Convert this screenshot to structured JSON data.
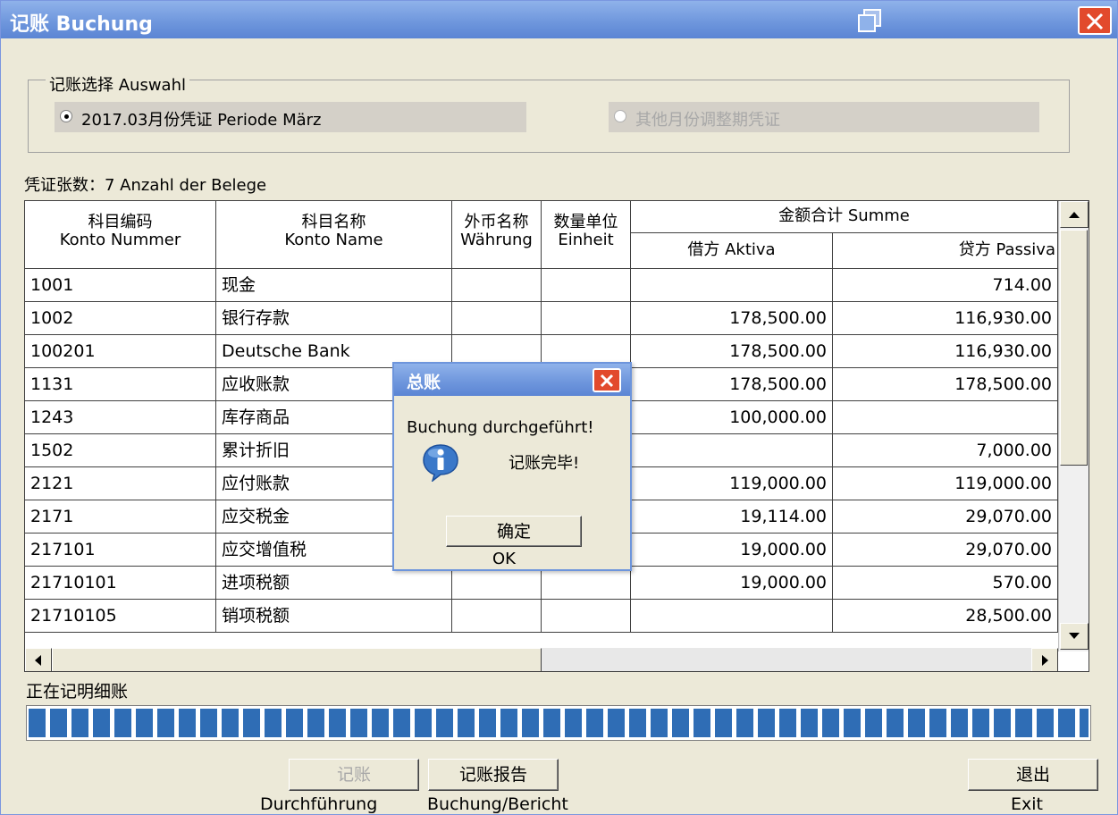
{
  "window": {
    "title": "记账 Buchung"
  },
  "selection": {
    "group_label": "记账选择 Auswahl",
    "option1_label": "2017.03月份凭证 Periode März",
    "option2_label": "其他月份调整期凭证"
  },
  "voucher_count": "凭证张数：7   Anzahl der Belege",
  "table": {
    "headers": {
      "code": [
        "科目编码",
        "Konto Nummer"
      ],
      "name": [
        "科目名称",
        "Konto Name"
      ],
      "currency": [
        "外币名称",
        "Währung"
      ],
      "unit": [
        "数量单位",
        "Einheit"
      ],
      "sum": "金额合计 Summe",
      "debit": "借方 Aktiva",
      "credit": "贷方 Passiva"
    },
    "rows": [
      {
        "code": "1001",
        "name": "现金",
        "debit": "",
        "credit": "714.00"
      },
      {
        "code": "1002",
        "name": "银行存款",
        "debit": "178,500.00",
        "credit": "116,930.00"
      },
      {
        "code": "100201",
        "name": "Deutsche Bank",
        "debit": "178,500.00",
        "credit": "116,930.00"
      },
      {
        "code": "1131",
        "name": "应收账款",
        "debit": "178,500.00",
        "credit": "178,500.00"
      },
      {
        "code": "1243",
        "name": "库存商品",
        "debit": "100,000.00",
        "credit": ""
      },
      {
        "code": "1502",
        "name": "累计折旧",
        "debit": "",
        "credit": "7,000.00"
      },
      {
        "code": "2121",
        "name": "应付账款",
        "debit": "119,000.00",
        "credit": "119,000.00"
      },
      {
        "code": "2171",
        "name": "应交税金",
        "debit": "19,114.00",
        "credit": "29,070.00"
      },
      {
        "code": "217101",
        "name": "应交增值税",
        "debit": "19,000.00",
        "credit": "29,070.00"
      },
      {
        "code": "21710101",
        "name": "进项税额",
        "debit": "19,000.00",
        "credit": "570.00"
      },
      {
        "code": "21710105",
        "name": "销项税额",
        "debit": "",
        "credit": "28,500.00"
      }
    ]
  },
  "status_text": "正在记明细账",
  "progress": {
    "fraction": 1.0
  },
  "buttons": {
    "post": "记账",
    "post_label": "Durchführung",
    "report": "记账报告",
    "report_label": "Buchung/Bericht",
    "exit": "退出",
    "exit_label": "Exit"
  },
  "dialog": {
    "title": "总账",
    "message_de": "Buchung durchgeführt!",
    "message_cn": "记账完毕!",
    "ok": "确定",
    "ok_label": "OK"
  },
  "colors": {
    "titlebar": "#6d95dc",
    "close": "#e24a2c",
    "progress": "#2f6db5"
  }
}
